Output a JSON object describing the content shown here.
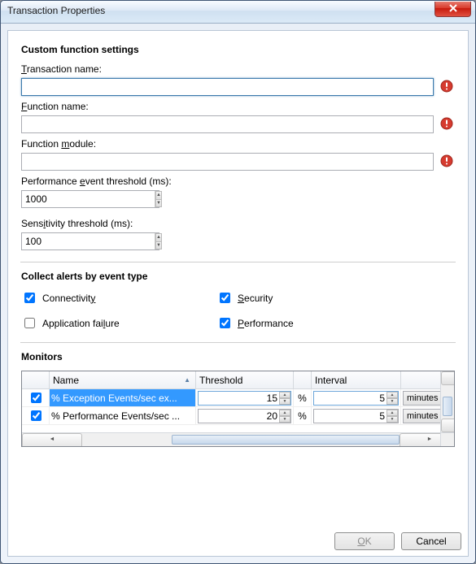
{
  "window": {
    "title": "Transaction Properties"
  },
  "sections": {
    "custom": {
      "heading": "Custom function settings"
    },
    "alerts": {
      "heading": "Collect alerts by event type"
    },
    "monitors": {
      "heading": "Monitors"
    }
  },
  "fields": {
    "transaction_name": {
      "label_pre": "",
      "label_key": "T",
      "label_post": "ransaction name:",
      "value": ""
    },
    "function_name": {
      "label_pre": "",
      "label_key": "F",
      "label_post": "unction name:",
      "value": ""
    },
    "function_module": {
      "label_pre": "Function ",
      "label_key": "m",
      "label_post": "odule:",
      "value": ""
    },
    "perf_threshold": {
      "label_pre": "Performance ",
      "label_key": "e",
      "label_post": "vent threshold (ms):",
      "value": "1000"
    },
    "sens_threshold": {
      "label_pre": "Sens",
      "label_key": "i",
      "label_post": "tivity threshold (ms):",
      "value": "100"
    }
  },
  "alerts": {
    "connectivity": {
      "label_pre": "Connectivit",
      "label_key": "y",
      "label_post": "",
      "checked": true
    },
    "security": {
      "label_pre": "",
      "label_key": "S",
      "label_post": "ecurity",
      "checked": true
    },
    "failure": {
      "label_pre": "Application fai",
      "label_key": "l",
      "label_post": "ure",
      "checked": false
    },
    "performance": {
      "label_pre": "",
      "label_key": "P",
      "label_post": "erformance",
      "checked": true
    }
  },
  "monitor_table": {
    "columns": {
      "name": "Name",
      "threshold": "Threshold",
      "interval": "Interval"
    },
    "rows": [
      {
        "checked": true,
        "name": "% Exception Events/sec ex...",
        "threshold": "15",
        "unit": "%",
        "interval": "5",
        "interval_unit": "minutes",
        "selected": true
      },
      {
        "checked": true,
        "name": "% Performance Events/sec ...",
        "threshold": "20",
        "unit": "%",
        "interval": "5",
        "interval_unit": "minutes",
        "selected": false
      }
    ]
  },
  "footer": {
    "ok_pre": "",
    "ok_key": "O",
    "ok_post": "K",
    "cancel": "Cancel"
  }
}
